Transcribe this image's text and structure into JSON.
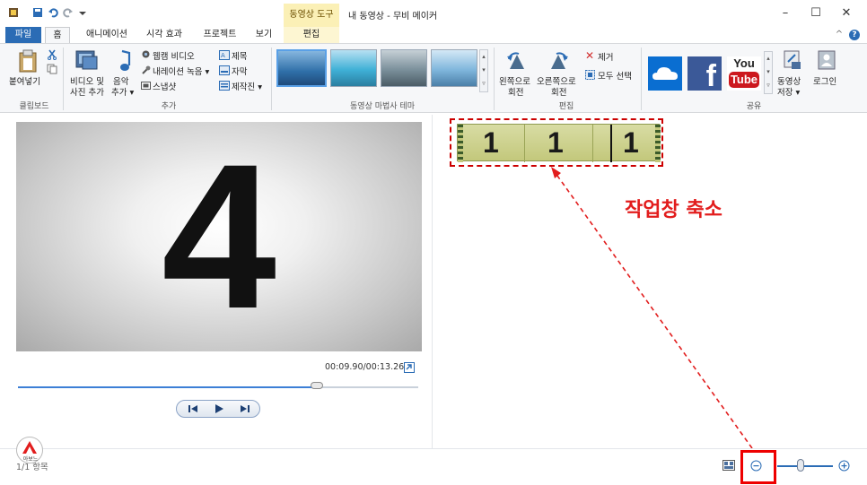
{
  "titlebar": {
    "context_tab": "동영상 도구",
    "window_title": "내 동영상 - 무비 메이커",
    "minimize": "–",
    "maximize": "☐",
    "close": "✕"
  },
  "tabs": {
    "file": "파일",
    "home": "홈",
    "animations": "애니메이션",
    "visual_effects": "시각 효과",
    "project": "프로젝트",
    "view": "보기",
    "edit": "편집",
    "collapse": "^"
  },
  "ribbon": {
    "clipboard": {
      "paste": "붙여넣기",
      "group": "클립보드"
    },
    "add": {
      "add_video_photo_1": "비디오 및",
      "add_video_photo_2": "사진 추가",
      "add_music_1": "음악",
      "add_music_2": "추가 ▾",
      "webcam_video": "웹캠 비디오",
      "record_narration": "내레이션 녹음 ▾",
      "snapshot": "스냅샷",
      "title": "제목",
      "caption": "자막",
      "credits": "제작진 ▾",
      "group": "추가"
    },
    "themes": {
      "group": "동영상 마법사 테마"
    },
    "editing": {
      "rotate_left_1": "왼쪽으로",
      "rotate_left_2": "회전",
      "rotate_right_1": "오른쪽으로",
      "rotate_right_2": "회전",
      "remove": "제거",
      "select_all": "모두 선택",
      "group": "편집"
    },
    "share": {
      "save_movie_1": "동영상",
      "save_movie_2": "저장 ▾",
      "sign_in": "로그인",
      "youtube_1": "You",
      "youtube_2": "Tube",
      "facebook": "f",
      "group": "공유"
    }
  },
  "preview": {
    "number": "4",
    "time": "00:09.90/00:13.26",
    "progress": 0.747
  },
  "storyboard": {
    "frames": [
      "1",
      "1",
      "1"
    ]
  },
  "annotation": {
    "text": "작업창 축소"
  },
  "status": {
    "logo": "아보느",
    "items": "1/1 항목"
  },
  "colors": {
    "accent": "#2b6cb5",
    "annotation_red": "#e21d1d",
    "context_tab": "#fbf0b6"
  }
}
